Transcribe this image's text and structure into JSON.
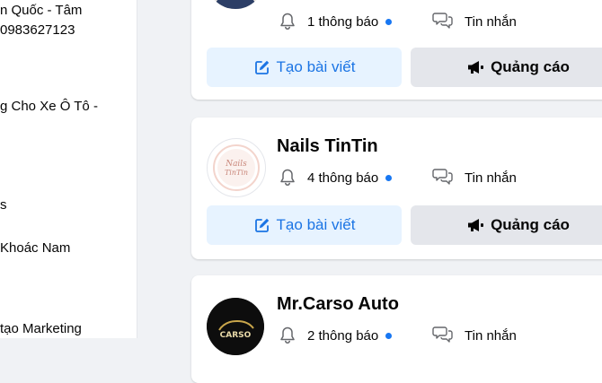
{
  "sidebar": {
    "lines": [
      "n Quốc - Tâm",
      "0983627123",
      "g Cho Xe Ô Tô -",
      "s",
      "Khoác Nam",
      "tạo Marketing"
    ]
  },
  "pages": [
    {
      "name": "",
      "notifications": "1 thông báo",
      "messages": "Tin nhắn",
      "post_label": "Tạo bài viết",
      "ad_label": "Quảng cáo"
    },
    {
      "name": "Nails TinTin",
      "avatar_text": "Nails TinTin",
      "notifications": "4 thông báo",
      "messages": "Tin nhắn",
      "post_label": "Tạo bài viết",
      "ad_label": "Quảng cáo"
    },
    {
      "name": "Mr.Carso Auto",
      "avatar_text": "CARSO",
      "notifications": "2 thông báo",
      "messages": "Tin nhắn"
    }
  ],
  "colors": {
    "accent": "#1877f2",
    "post_button_bg": "#e7f3ff",
    "post_button_text": "#1b74e4",
    "ad_button_bg": "#e4e6eb",
    "page_bg": "#f0f2f5"
  },
  "icons": {
    "notification": "bell-icon",
    "messages": "chat-bubbles-icon",
    "post": "edit-square-icon",
    "ad": "megaphone-icon"
  }
}
